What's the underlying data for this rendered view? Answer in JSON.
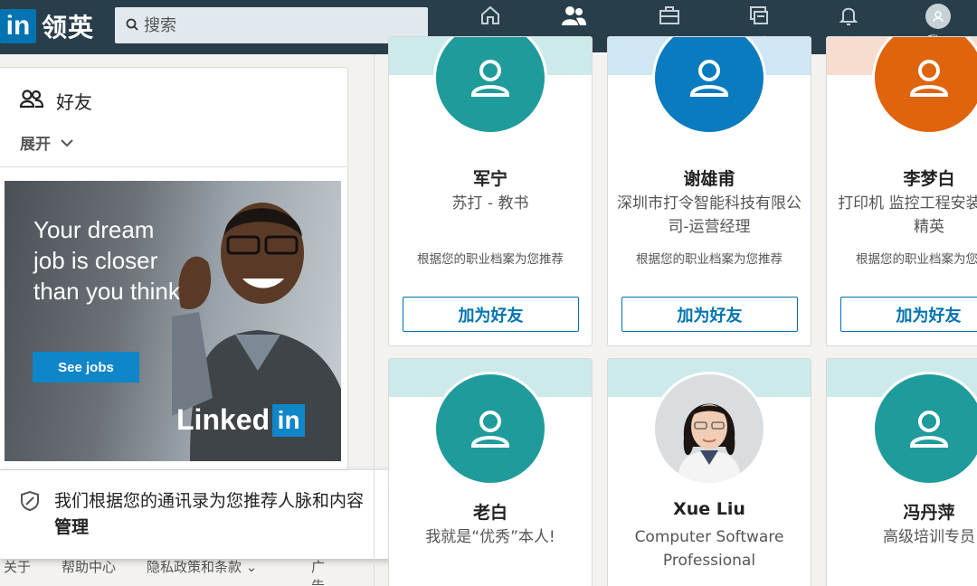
{
  "nav": {
    "logo_in": "in",
    "logo_text": "领英",
    "search_placeholder": "搜索",
    "items": [
      {
        "label": "主页",
        "icon": "home-icon"
      },
      {
        "label": "人脉",
        "icon": "network-icon"
      },
      {
        "label": "职位",
        "icon": "jobs-icon"
      },
      {
        "label": "消息",
        "icon": "messaging-icon"
      },
      {
        "label": "通知",
        "icon": "notifications-icon"
      },
      {
        "label": "我",
        "icon": "avatar-icon"
      }
    ],
    "active_item": "人脉"
  },
  "sidebar": {
    "friends_label": "好友",
    "expand_label": "展开"
  },
  "ad": {
    "headline": "Your dream job is closer than you think",
    "button": "See jobs",
    "logo_word": "Linked",
    "logo_in": "in"
  },
  "toast": {
    "text": "我们根据您的通讯录为您推荐人脉和内容",
    "manage": "管理",
    "close": "×"
  },
  "footer": [
    "关于",
    "帮助中心",
    "隐私政策和条款 ⌄",
    "广告"
  ],
  "people": [
    {
      "name": "军宁",
      "title": "苏打 - 教书",
      "reason": "根据您的职业档案为您推荐",
      "button": "加为好友",
      "avatar_color": "#1f9b9b",
      "banner_color": "#cdeaea"
    },
    {
      "name": "谢雄甫",
      "title": "深圳市打令智能科技有限公司-运营经理",
      "reason": "根据您的职业档案为您推荐",
      "button": "加为好友",
      "avatar_color": "#0a7bbf",
      "banner_color": "#cfe6f5"
    },
    {
      "name": "李梦白",
      "title": "打印机 监控工程安装 — IT精英",
      "reason": "根据您的职业档案为您推荐",
      "button": "加为好友",
      "avatar_color": "#e0630d",
      "banner_color": "#f6ddd0"
    },
    {
      "name": "老白",
      "title": "我就是“优秀”本人!",
      "reason": "",
      "button": "",
      "avatar_color": "#1f9b9b",
      "banner_color": "#cdeaea"
    },
    {
      "name": "Xue Liu",
      "title": "Computer Software Professional",
      "reason": "",
      "button": "",
      "avatar_color": "#e9eef1",
      "banner_color": "#cdeaea"
    },
    {
      "name": "冯丹萍",
      "title": "高级培训专员",
      "reason": "",
      "button": "",
      "avatar_color": "#1f9b9b",
      "banner_color": "#cdeaea"
    }
  ]
}
